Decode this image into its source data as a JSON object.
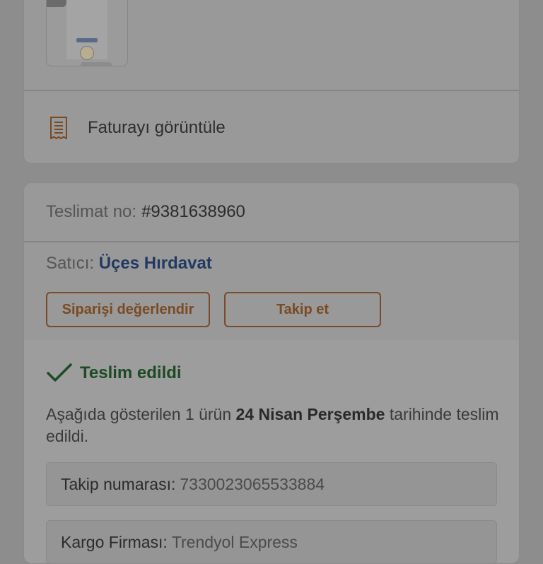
{
  "invoice": {
    "label": "Faturayı görüntüle",
    "icon": "receipt-icon"
  },
  "delivery": {
    "number_label": "Teslimat no:",
    "number_value": "#9381638960",
    "seller_label": "Satıcı:",
    "seller_name": "Üçes Hırdavat",
    "rate_button": "Siparişi değerlendir",
    "follow_button": "Takip et",
    "status": "Teslim edildi",
    "status_icon": "checkmark-icon",
    "description_prefix": "Aşağıda gösterilen 1 ürün",
    "description_date": "24 Nisan Perşembe",
    "description_suffix": "tarihinde teslim edildi.",
    "tracking_label": "Takip numarası:",
    "tracking_value": "7330023065533884",
    "carrier_label": "Kargo Firması:",
    "carrier_value": "Trendyol Express"
  },
  "colors": {
    "accent_orange": "#7a4a22",
    "link_blue": "#223a63",
    "status_green": "#1e4a25"
  }
}
